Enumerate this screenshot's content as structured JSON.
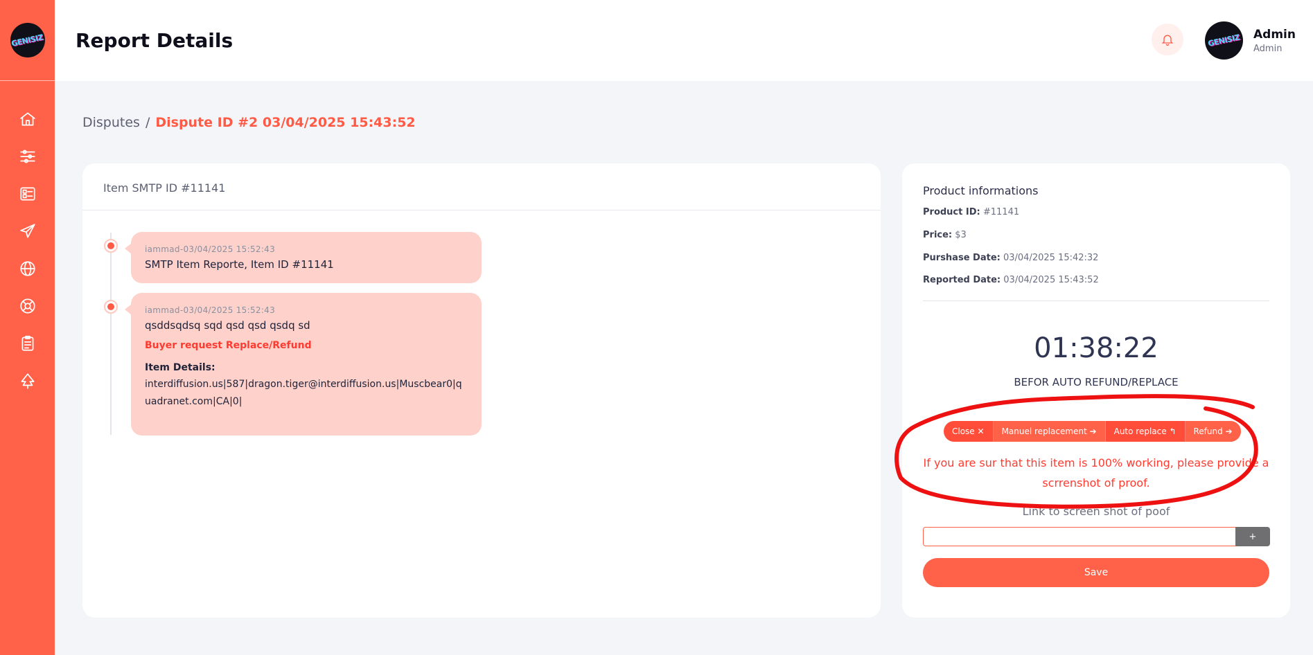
{
  "brand": {
    "logo_text": "GENISIZ",
    "accent": "#ff6149",
    "danger": "#ff3b30"
  },
  "sidebar": {
    "items": [
      {
        "name": "home",
        "icon": "home-icon"
      },
      {
        "name": "filters",
        "icon": "sliders-icon"
      },
      {
        "name": "dashboard",
        "icon": "list-card-icon"
      },
      {
        "name": "send",
        "icon": "paper-plane-icon"
      },
      {
        "name": "web",
        "icon": "globe-icon"
      },
      {
        "name": "support",
        "icon": "lifebuoy-icon"
      },
      {
        "name": "reports",
        "icon": "clipboard-icon"
      },
      {
        "name": "tree",
        "icon": "tree-icon"
      }
    ]
  },
  "header": {
    "title": "Report Details",
    "user": {
      "name": "Admin",
      "role": "Admin"
    }
  },
  "breadcrumb": {
    "root": "Disputes",
    "separator": "/",
    "current": "Dispute ID #2 03/04/2025 15:43:52"
  },
  "conversation": {
    "title": "Item SMTP ID #11141",
    "messages": [
      {
        "meta": "iammad-03/04/2025 15:52:43",
        "text": "SMTP Item Reporte, Item ID #11141"
      },
      {
        "meta": "iammad-03/04/2025 15:52:43",
        "text": "qsddsqdsq sqd qsd qsd qsdq sd",
        "request": "Buyer request Replace/Refund",
        "details_label": "Item Details:",
        "details": "interdiffusion.us|587|dragon.tiger@interdiffusion.us|Muscbear0|quadranet.com|CA|0|"
      }
    ]
  },
  "product": {
    "title": "Product informations",
    "rows": [
      {
        "label": "Product ID:",
        "value": "#11141"
      },
      {
        "label": "Price:",
        "value": "$3"
      },
      {
        "label": "Purshase Date:",
        "value": "03/04/2025 15:42:32"
      },
      {
        "label": "Reported Date:",
        "value": "03/04/2025 15:43:52"
      }
    ],
    "timer": "01:38:22",
    "timer_label": "BEFOR AUTO REFUND/REPLACE",
    "actions": [
      {
        "label": "Close ✕"
      },
      {
        "label": "Manuel replacement ➔"
      },
      {
        "label": "Auto replace ↰"
      },
      {
        "label": "Refund ➔"
      }
    ],
    "warning": "If you are sur that this item is 100% working, please provide a scrrenshot of proof.",
    "link_label": "Link to screen shot of poof",
    "link_value": "",
    "add_label": "+",
    "save_label": "Save"
  }
}
